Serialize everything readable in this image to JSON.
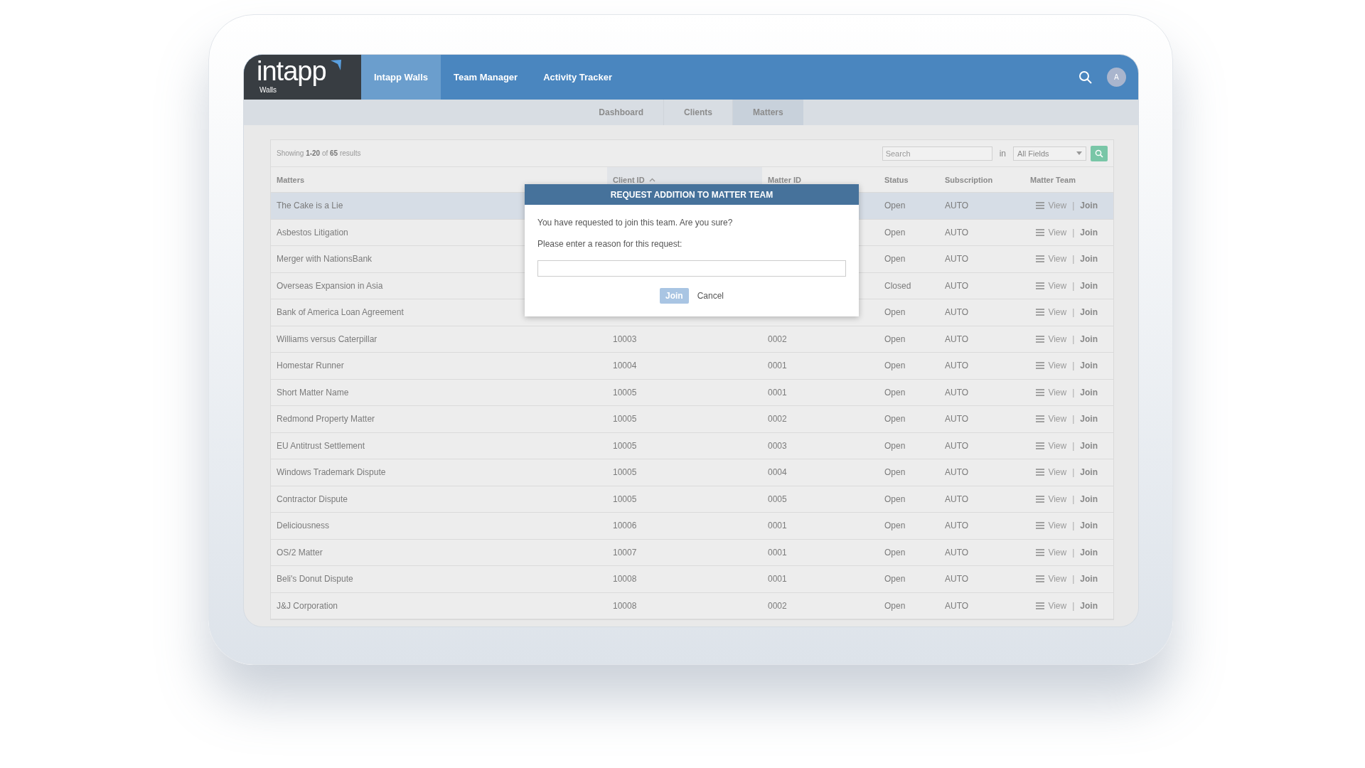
{
  "app": {
    "logo": "intapp",
    "product": "Walls"
  },
  "nav": [
    {
      "label": "Intapp Walls",
      "selected": true
    },
    {
      "label": "Team Manager",
      "selected": false
    },
    {
      "label": "Activity Tracker",
      "selected": false
    }
  ],
  "user": {
    "avatar": "A"
  },
  "subnav": [
    {
      "label": "Dashboard",
      "selected": false
    },
    {
      "label": "Clients",
      "selected": false
    },
    {
      "label": "Matters",
      "selected": true
    }
  ],
  "results": "Showing **1-20** of **65** results",
  "search": {
    "placeholder": "Search",
    "in_label": "in",
    "field": "All Fields"
  },
  "table": {
    "columns": [
      {
        "label": "Matters",
        "sorted": false
      },
      {
        "label": "Client ID",
        "sorted": true
      },
      {
        "label": "Matter ID",
        "sorted": false
      },
      {
        "label": "Status",
        "sorted": false
      },
      {
        "label": "Subscription",
        "sorted": false
      },
      {
        "label": "Matter Team",
        "sorted": false
      }
    ],
    "rows": [
      {
        "matter": "The Cake is a Lie",
        "status": "Open",
        "subscription": "AUTO",
        "view": "View",
        "separator": "|",
        "join": "Join",
        "highlighted": true
      },
      {
        "matter": "Asbestos Litigation",
        "status": "Open",
        "subscription": "AUTO",
        "view": "View",
        "separator": "|",
        "join": "Join",
        "highlighted": false
      },
      {
        "matter": "Merger with NationsBank",
        "status": "Open",
        "subscription": "AUTO",
        "view": "View",
        "separator": "|",
        "join": "Join",
        "highlighted": false
      },
      {
        "matter": "Overseas Expansion in Asia",
        "status": "Closed",
        "subscription": "AUTO",
        "view": "View",
        "separator": "|",
        "join": "Join",
        "highlighted": false
      },
      {
        "matter": "Bank of America Loan Agreement",
        "status": "Open",
        "subscription": "AUTO",
        "view": "View",
        "separator": "|",
        "join": "Join",
        "highlighted": false
      },
      {
        "matter": "Williams versus Caterpillar",
        "client_id": "10003",
        "matter_id": "0002",
        "status": "Open",
        "subscription": "AUTO",
        "view": "View",
        "separator": "|",
        "join": "Join",
        "highlighted": false
      },
      {
        "matter": "Homestar Runner",
        "client_id": "10004",
        "matter_id": "0001",
        "status": "Open",
        "subscription": "AUTO",
        "view": "View",
        "separator": "|",
        "join": "Join",
        "highlighted": false
      },
      {
        "matter": "Short Matter Name",
        "client_id": "10005",
        "matter_id": "0001",
        "status": "Open",
        "subscription": "AUTO",
        "view": "View",
        "separator": "|",
        "join": "Join",
        "highlighted": false
      },
      {
        "matter": "Redmond Property Matter",
        "client_id": "10005",
        "matter_id": "0002",
        "status": "Open",
        "subscription": "AUTO",
        "view": "View",
        "separator": "|",
        "join": "Join",
        "highlighted": false
      },
      {
        "matter": "EU Antitrust Settlement",
        "client_id": "10005",
        "matter_id": "0003",
        "status": "Open",
        "subscription": "AUTO",
        "view": "View",
        "separator": "|",
        "join": "Join",
        "highlighted": false
      },
      {
        "matter": "Windows Trademark Dispute",
        "client_id": "10005",
        "matter_id": "0004",
        "status": "Open",
        "subscription": "AUTO",
        "view": "View",
        "separator": "|",
        "join": "Join",
        "highlighted": false
      },
      {
        "matter": "Contractor Dispute",
        "client_id": "10005",
        "matter_id": "0005",
        "status": "Open",
        "subscription": "AUTO",
        "view": "View",
        "separator": "|",
        "join": "Join",
        "highlighted": false
      },
      {
        "matter": "Deliciousness",
        "client_id": "10006",
        "matter_id": "0001",
        "status": "Open",
        "subscription": "AUTO",
        "view": "View",
        "separator": "|",
        "join": "Join",
        "highlighted": false
      },
      {
        "matter": "OS/2 Matter",
        "client_id": "10007",
        "matter_id": "0001",
        "status": "Open",
        "subscription": "AUTO",
        "view": "View",
        "separator": "|",
        "join": "Join",
        "highlighted": false
      },
      {
        "matter": "Beli's Donut Dispute",
        "client_id": "10008",
        "matter_id": "0001",
        "status": "Open",
        "subscription": "AUTO",
        "view": "View",
        "separator": "|",
        "join": "Join",
        "highlighted": false
      },
      {
        "matter": "J&J Corporation",
        "client_id": "10008",
        "matter_id": "0002",
        "status": "Open",
        "subscription": "AUTO",
        "view": "View",
        "separator": "|",
        "join": "Join",
        "highlighted": false
      }
    ]
  },
  "dialog": {
    "title": "REQUEST ADDITION TO MATTER TEAM",
    "message": "You have requested to join this team. Are you sure?",
    "prompt": "Please enter a reason for this request:",
    "join": {
      "label": "Join",
      "disabled": true
    },
    "cancel": "Cancel"
  }
}
